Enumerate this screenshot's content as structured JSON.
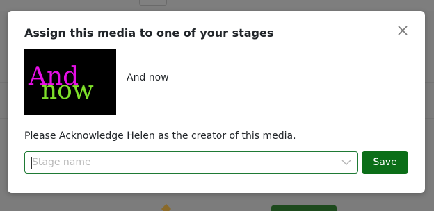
{
  "modal": {
    "title": "Assign this media to one of your stages",
    "media_name": "And now",
    "thumbnail_text_1": "And",
    "thumbnail_text_2": "now",
    "acknowledge_text": "Please Acknowledge Helen as the creator of this media.",
    "stage_select_placeholder": "Stage name",
    "save_label": "Save",
    "close_icon": "close-icon",
    "dropdown_icon": "chevron-down-icon"
  },
  "colors": {
    "accent": "#0b6e18",
    "thumb_magenta": "#e60fe6",
    "thumb_green": "#7ee02a"
  }
}
